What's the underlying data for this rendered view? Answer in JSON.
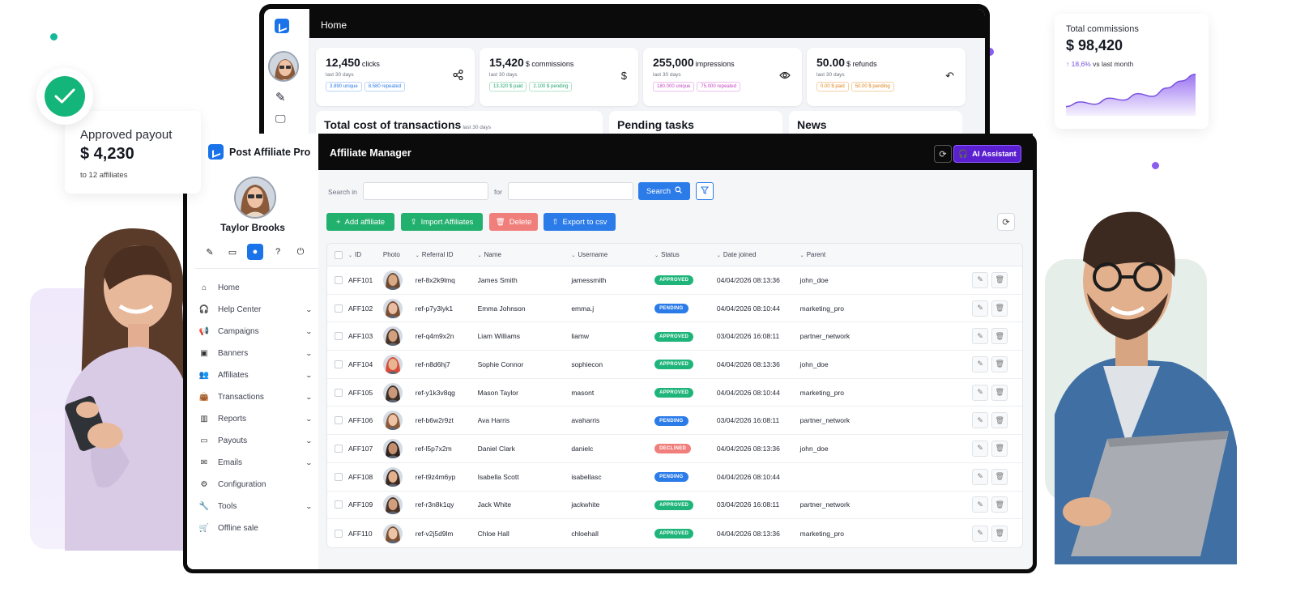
{
  "dashboard": {
    "title": "Home",
    "stats": [
      {
        "value": "12,450",
        "unit": "clicks",
        "period": "last 30 days",
        "pills": [
          "3.890 unique",
          "8.580 repeated"
        ],
        "icon": "share-icon"
      },
      {
        "value": "15,420",
        "unit": "$ commissions",
        "period": "last 30 days",
        "pills": [
          "13.320 $ paid",
          "2.100 $ pending"
        ],
        "icon": "dollar-icon"
      },
      {
        "value": "255,000",
        "unit": "impressions",
        "period": "last 30 days",
        "pills": [
          "180.000 unique",
          "75.000 repeated"
        ],
        "icon": "eye-icon"
      },
      {
        "value": "50.00",
        "unit": "$ refunds",
        "period": "last 30 days",
        "pills": [
          "0.00 $ paid",
          "50.00 $ pending"
        ],
        "icon": "undo-icon"
      }
    ],
    "cards": [
      {
        "title": "Total cost of transactions",
        "sub": "last 30 days"
      },
      {
        "title": "Pending tasks",
        "sub": ""
      },
      {
        "title": "News",
        "sub": ""
      }
    ]
  },
  "payout_card": {
    "title": "Approved payout",
    "amount": "$ 4,230",
    "sub": "to 12 affiliates"
  },
  "commissions_card": {
    "title": "Total commissions",
    "amount": "$ 98,420",
    "delta_value": "18,6%",
    "delta_text": "vs last month",
    "trend": [
      2,
      3,
      2.5,
      3.8,
      3.4,
      4.8,
      4.2,
      6,
      7.5,
      9
    ]
  },
  "app": {
    "brand": "Post Affiliate Pro",
    "user_name": "Taylor Brooks",
    "page_title": "Affiliate Manager",
    "ai_button": "AI Assistant",
    "nav": [
      {
        "label": "Home",
        "icon": "home-icon",
        "chevron": false
      },
      {
        "label": "Help Center",
        "icon": "headset-icon",
        "chevron": true
      },
      {
        "label": "Campaigns",
        "icon": "megaphone-icon",
        "chevron": true
      },
      {
        "label": "Banners",
        "icon": "image-icon",
        "chevron": true
      },
      {
        "label": "Affiliates",
        "icon": "users-icon",
        "chevron": true
      },
      {
        "label": "Transactions",
        "icon": "bag-icon",
        "chevron": true
      },
      {
        "label": "Reports",
        "icon": "chart-icon",
        "chevron": true
      },
      {
        "label": "Payouts",
        "icon": "card-icon",
        "chevron": true
      },
      {
        "label": "Emails",
        "icon": "mail-icon",
        "chevron": true
      },
      {
        "label": "Configuration",
        "icon": "gear-icon",
        "chevron": false
      },
      {
        "label": "Tools",
        "icon": "wrench-icon",
        "chevron": true
      },
      {
        "label": "Offline sale",
        "icon": "cart-icon",
        "chevron": false
      }
    ],
    "search": {
      "search_in_label": "Search in",
      "for_label": "for",
      "search_in_value": "",
      "for_value": "",
      "button": "Search"
    },
    "actions": {
      "add": "Add affiliate",
      "import": "Import Affiliates",
      "delete": "Delete",
      "export": "Export to csv"
    },
    "columns": [
      "ID",
      "Photo",
      "Referral ID",
      "Name",
      "Username",
      "Status",
      "Date joined",
      "Parent"
    ],
    "rows": [
      {
        "id": "AFF101",
        "ref": "ref-8x2k9lmq",
        "name": "James Smith",
        "user": "jamessmith",
        "status": "APPROVED",
        "date": "04/04/2026 08:13:36",
        "parent": "john_doe"
      },
      {
        "id": "AFF102",
        "ref": "ref-p7y3lyk1",
        "name": "Emma Johnson",
        "user": "emma.j",
        "status": "PENDING",
        "date": "04/04/2026 08:10:44",
        "parent": "marketing_pro"
      },
      {
        "id": "AFF103",
        "ref": "ref-q4m9x2n",
        "name": "Liam Williams",
        "user": "liamw",
        "status": "APPROVED",
        "date": "03/04/2026 16:08:11",
        "parent": "partner_network"
      },
      {
        "id": "AFF104",
        "ref": "ref-n8d6hj7",
        "name": "Sophie Connor",
        "user": "sophiecon",
        "status": "APPROVED",
        "date": "04/04/2026 08:13:36",
        "parent": "john_doe"
      },
      {
        "id": "AFF105",
        "ref": "ref-y1k3v8qg",
        "name": "Mason Taylor",
        "user": "masont",
        "status": "APPROVED",
        "date": "04/04/2026 08:10:44",
        "parent": "marketing_pro"
      },
      {
        "id": "AFF106",
        "ref": "ref-b6w2r9zt",
        "name": "Ava Harris",
        "user": "avaharris",
        "status": "PENDING",
        "date": "03/04/2026 16:08:11",
        "parent": "partner_network"
      },
      {
        "id": "AFF107",
        "ref": "ref-l5p7x2m",
        "name": "Daniel Clark",
        "user": "danielc",
        "status": "DECLINED",
        "date": "04/04/2026 08:13:36",
        "parent": "john_doe"
      },
      {
        "id": "AFF108",
        "ref": "ref-t9z4m6yp",
        "name": "Isabella Scott",
        "user": "isabellasc",
        "status": "PENDING",
        "date": "04/04/2026 08:10:44",
        "parent": ""
      },
      {
        "id": "AFF109",
        "ref": "ref-r3n8k1qy",
        "name": "Jack White",
        "user": "jackwhite",
        "status": "APPROVED",
        "date": "03/04/2026 16:08:11",
        "parent": "partner_network"
      },
      {
        "id": "AFF110",
        "ref": "ref-v2j5d9lm",
        "name": "Chloe Hall",
        "user": "chloehall",
        "status": "APPROVED",
        "date": "04/04/2026 08:13:36",
        "parent": "marketing_pro"
      }
    ],
    "status_colors": {
      "APPROVED": "#1fb57a",
      "PENDING": "#2b7be9",
      "DECLINED": "#f07f7c"
    }
  },
  "colors": {
    "brand_blue": "#1a73e8",
    "ai_purple": "#5a1fd1",
    "add_green": "#22b06e",
    "delete_red": "#f07f7c",
    "export_blue": "#2b7be9",
    "accent_teal": "#14b89a",
    "accent_purple": "#8a5cf0"
  }
}
